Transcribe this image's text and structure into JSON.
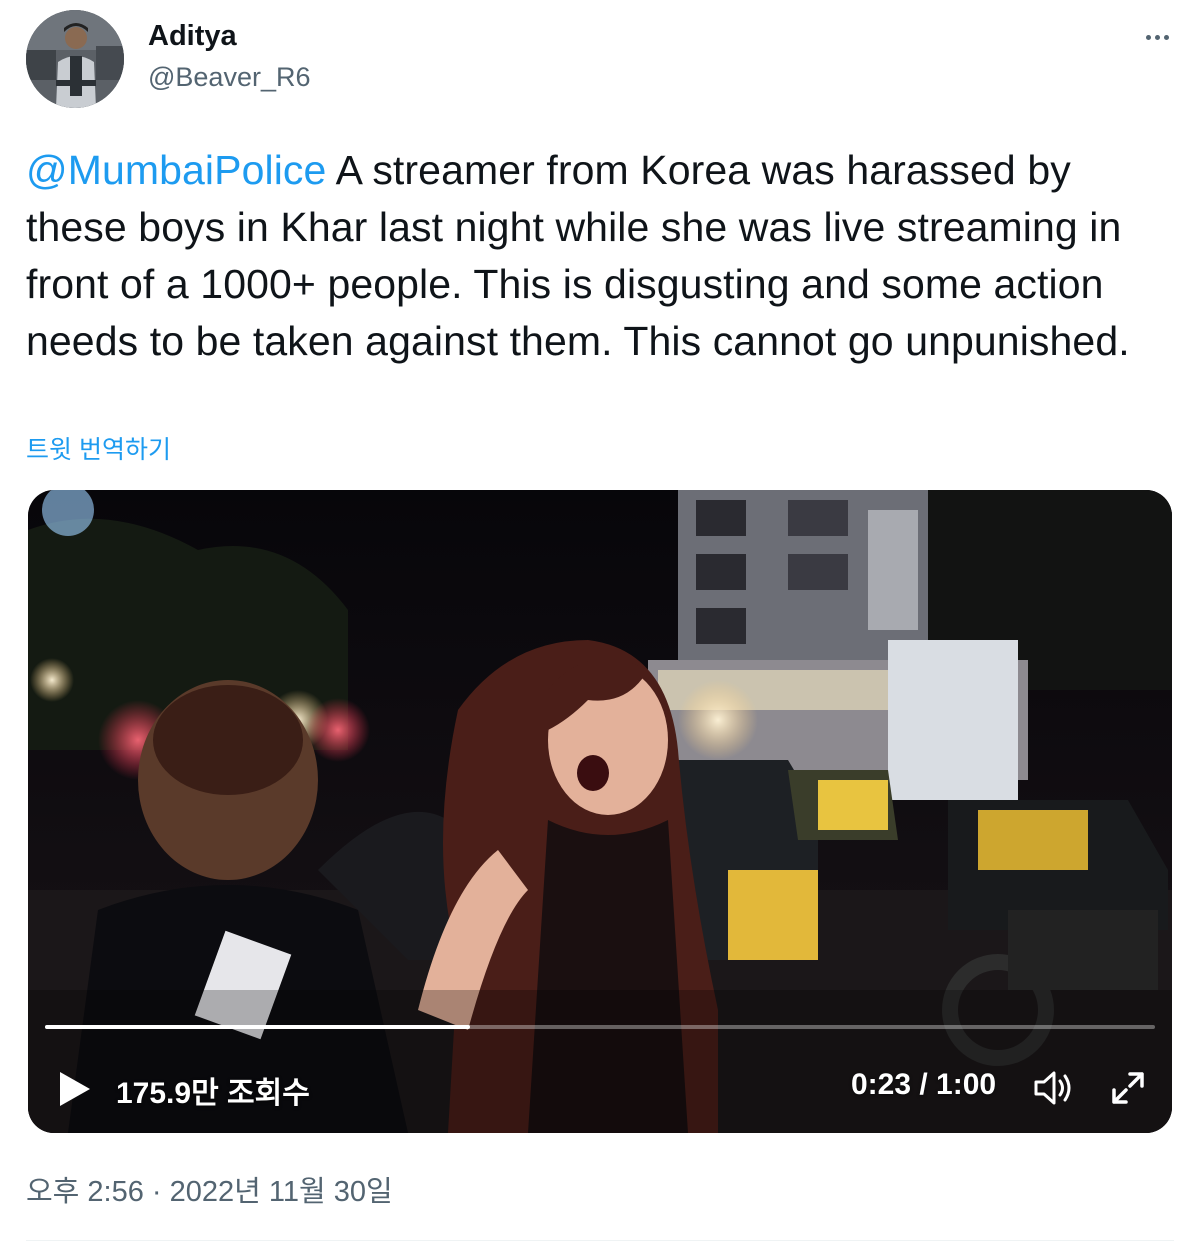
{
  "author": {
    "name": "Aditya",
    "handle": "@Beaver_R6"
  },
  "tweet": {
    "mention": "@MumbaiPolice",
    "text": " A streamer from Korea was harassed by these boys in Khar last night while she was live streaming in front of a 1000+ people. This is disgusting and some action needs to be taken against them. This cannot go unpunished.",
    "translate_label": "트윗 번역하기"
  },
  "video": {
    "views": "175.9만 조회수",
    "time": "0:23 / 1:00",
    "progress_fraction": 0.383
  },
  "timestamp": "오후 2:56 · 2022년 11월 30일",
  "colors": {
    "link": "#1d9bf0",
    "secondary_text": "#536471"
  },
  "icons": {
    "more": "more-horizontal-icon",
    "play": "play-icon",
    "volume": "volume-icon",
    "fullscreen": "fullscreen-expand-icon"
  }
}
